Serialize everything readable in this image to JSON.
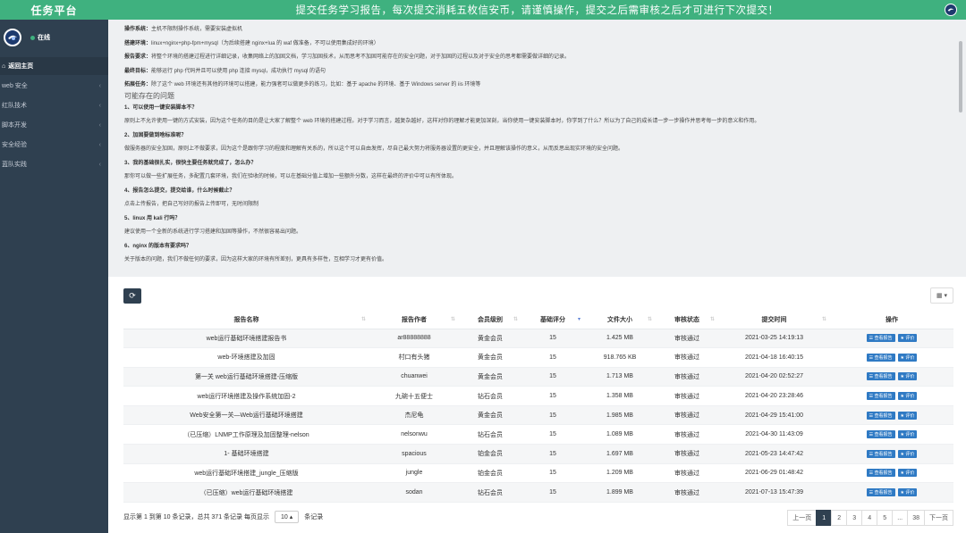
{
  "sidebar": {
    "brand": "任务平台",
    "status": "在线",
    "items": [
      {
        "label": "返回主页"
      },
      {
        "label": "web 安全"
      },
      {
        "label": "红队技术"
      },
      {
        "label": "脚本开发"
      },
      {
        "label": "安全经验"
      },
      {
        "label": "蓝队实践"
      }
    ]
  },
  "topbar": {
    "title": "提交任务学习报告，每次提交消耗五枚信安币，请谨慎操作，提交之后需审核之后才可进行下次提交！"
  },
  "info": {
    "lines": [
      {
        "key": "操作系统：",
        "text": "主机不限制操作系统，需要安装虚拟机"
      },
      {
        "key": "搭建环境：",
        "text": "linux+nginx+php-fpm+mysql（为后续搭建 nginx+lua 的 waf 做准备，不可以使用集成好的环境）"
      },
      {
        "key": "报告要求：",
        "text": "将整个环境的搭建过程进行详细记录，收集网络上的加固文档，学习加固技术，从而思考不加固可能存在的安全问题，对于加固的过程以及对于安全的思考都需要做详细的记录。"
      },
      {
        "key": "最终目标：",
        "text": "能够运行 php 代码并且可以使用 php 连接 mysql，成功执行 mysql 的语句"
      },
      {
        "key": "拓展任务：",
        "text": "除了这个 web 环境还有其他的环境可以搭建，能力强者可以做更多的练习，比如：基于 apache 的环境、基于 Windows server 的 iis 环境等"
      }
    ],
    "faq_title": "可能存在的问题",
    "faq": [
      {
        "q": "1、可以使用一键安装脚本不？",
        "a": "原则上不允许使用一键的方式安装，因为这个任务的目的是让大家了解整个 web 环境的搭建过程。对于学习而言，越复杂越好，这样对你的理解才能更加深刻，当你使用一键安装脚本时，你学到了什么？所以为了自己的成长请一步一步操作并思考每一步的意义和作用。"
      },
      {
        "q": "2、加固要做到啥标准呢？",
        "a": "做服务器的安全加固，原则上不做要求，因为这个是跟你学习的程度和理解有关系的，所以这个可以自由发挥，尽自己最大努力将服务器设置的更安全，并且理解该操作的意义，从而反思出现实环境的安全问题。"
      },
      {
        "q": "3、我的基础很扎实，很快主要任务就完成了，怎么办？",
        "a": "那你可以做一些扩展任务，多配置几套环境，我们在验收的时候，可以在基础分值上增加一些额外分数，这样在最终的评价中可以有所体现。"
      },
      {
        "q": "4、报告怎么提交，提交给谁，什么时候截止？",
        "a": "点击上传报告，把自己写好的报告上传即可，无时间限制"
      },
      {
        "q": "5、linux 用 kali 行吗？",
        "a": "建议使用一个全新的系统进行学习搭建和加固等操作，不然很容易出问题。"
      },
      {
        "q": "6、nginx 的版本有要求吗？",
        "a": "关于版本的问题，我们不做任何的要求，因为这样大家的环境有所差别，更具有多样性，互相学习才更有价值。"
      }
    ]
  },
  "table": {
    "headers": [
      "报告名称",
      "报告作者",
      "会员级别",
      "基础评分",
      "文件大小",
      "审核状态",
      "提交时间",
      "操作"
    ],
    "action_view": "查看报告",
    "action_rate": "评价",
    "rows": [
      [
        "web运行基础环境搭建报告书",
        "ar88888888",
        "黄金会员",
        "15",
        "1.425 MB",
        "审核通过",
        "2021-03-25 14:19:13"
      ],
      [
        "web-环境搭建及加固",
        "村口有头猪",
        "黄金会员",
        "15",
        "918.765 KB",
        "审核通过",
        "2021-04-18 16:40:15"
      ],
      [
        "第一关 web运行基础环境搭建-压缩版",
        "chuanwei",
        "黄金会员",
        "15",
        "1.713 MB",
        "审核通过",
        "2021-04-20 02:52:27"
      ],
      [
        "web运行环境搭建及操作系统加固-2",
        "九碗十五便士",
        "钻石会员",
        "15",
        "1.358 MB",
        "审核通过",
        "2021-04-20 23:28:46"
      ],
      [
        "Web安全第一关—Web运行基础环境搭建",
        "杰尼龟",
        "黄金会员",
        "15",
        "1.985 MB",
        "审核通过",
        "2021-04-29 15:41:00"
      ],
      [
        "（已压缩）LNMP工作原理及加固整理-nelson",
        "nelsonwu",
        "钻石会员",
        "15",
        "1.089 MB",
        "审核通过",
        "2021-04-30 11:43:09"
      ],
      [
        "1- 基础环境搭建",
        "spacious",
        "铂金会员",
        "15",
        "1.697 MB",
        "审核通过",
        "2021-05-23 14:47:42"
      ],
      [
        "web运行基础环境搭建_jungle_压缩版",
        "jungle",
        "铂金会员",
        "15",
        "1.209 MB",
        "审核通过",
        "2021-06-29 01:48:42"
      ],
      [
        "（已压缩）web运行基础环境搭建",
        "sodan",
        "钻石会员",
        "15",
        "1.899 MB",
        "审核通过",
        "2021-07-13 15:47:39"
      ]
    ]
  },
  "footer": {
    "summary": "显示第 1 到第 10 条记录，总共 371 条记录 每页显示",
    "page_size": "10",
    "suffix": "条记录"
  },
  "pager": [
    "上一页",
    "1",
    "2",
    "3",
    "4",
    "5",
    "...",
    "38",
    "下一页"
  ],
  "colors": {
    "brand": "#3fb17f",
    "sidebar": "#2f4050",
    "accent": "#2f7ac4"
  }
}
